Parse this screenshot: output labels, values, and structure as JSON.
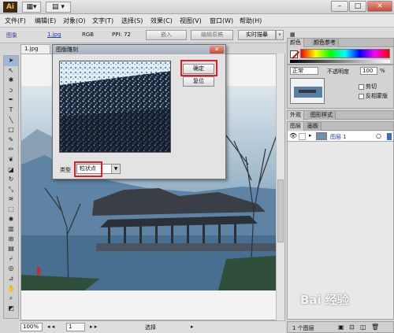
{
  "app": {
    "logo": "Ai"
  },
  "window": {
    "minimize": "–",
    "restore": "□",
    "close": "✕"
  },
  "menu": [
    "文件(F)",
    "编辑(E)",
    "对象(O)",
    "文字(T)",
    "选择(S)",
    "效果(C)",
    "视图(V)",
    "窗口(W)",
    "帮助(H)"
  ],
  "control": {
    "label": "图象",
    "file": "1.jpg",
    "mode": "RGB",
    "ppi": "PPI: 72",
    "embed": "嵌入",
    "edit_original": "编辑原稿",
    "live_trace": "实时描摹"
  },
  "document": {
    "tab": "1.jpg"
  },
  "status": {
    "zoom": "100%",
    "page": "1",
    "selection": "选择"
  },
  "dialog": {
    "title": "图版雕刻",
    "close": "✕",
    "ok": "确定",
    "reset": "复位",
    "type_label": "类型",
    "type_value": "粒状点"
  },
  "color_panel": {
    "tabs": [
      "颜色",
      "颜色参考"
    ]
  },
  "transparency": {
    "blend_mode": "正常",
    "opacity_label": "不透明度",
    "opacity": "100",
    "unit": "%",
    "clip": "剪切",
    "invert_mask": "反相蒙版"
  },
  "appearance_tabs": [
    "外观",
    "图形样式"
  ],
  "layers": {
    "tabs": [
      "图层",
      "画板"
    ],
    "layer_name": "图层 1",
    "count": "1 个图层"
  },
  "watermark": "Bai 经验",
  "colors": {
    "accent": "#3a6fc8",
    "highlight": "#e02020"
  }
}
